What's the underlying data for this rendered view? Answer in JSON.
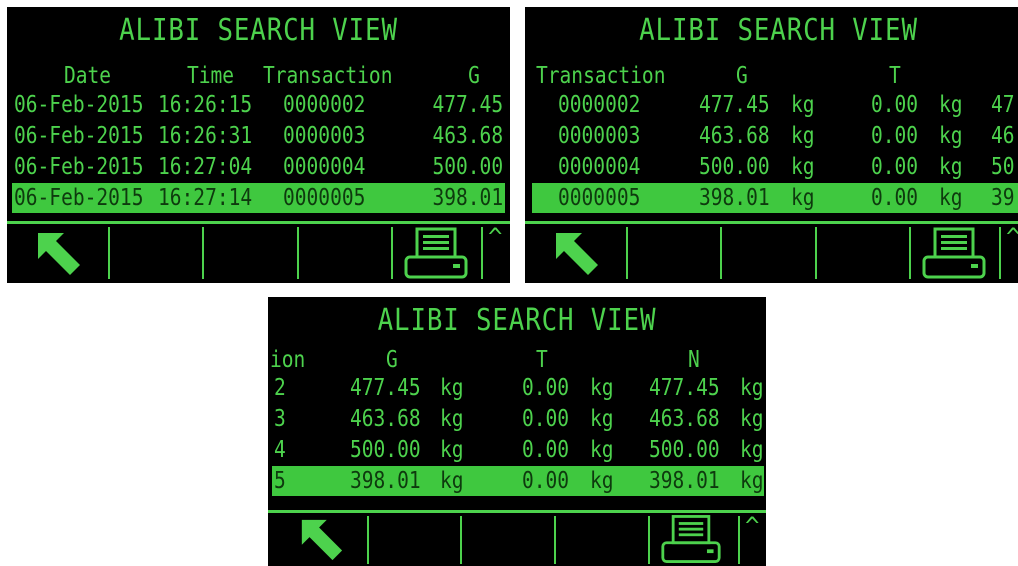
{
  "title": "ALIBI SEARCH VIEW",
  "colors": {
    "screen": "#000000",
    "text": "#4dd24d",
    "highlight": "#3fc83f",
    "highlight_text": "#0e3a0e"
  },
  "icons": {
    "back": "arrow-up-left-icon",
    "print": "printer-icon",
    "scroll": "caret-up-icon"
  },
  "scroll_glyph": "^",
  "panel1": {
    "headers": {
      "date": "Date",
      "time": "Time",
      "transaction": "Transaction",
      "g": "G"
    },
    "rows": [
      {
        "date": "06-Feb-2015",
        "time": "16:26:15",
        "transaction": "0000002",
        "g": "477.45"
      },
      {
        "date": "06-Feb-2015",
        "time": "16:26:31",
        "transaction": "0000003",
        "g": "463.68"
      },
      {
        "date": "06-Feb-2015",
        "time": "16:27:04",
        "transaction": "0000004",
        "g": "500.00"
      },
      {
        "date": "06-Feb-2015",
        "time": "16:27:14",
        "transaction": "0000005",
        "g": "398.01"
      }
    ]
  },
  "panel2": {
    "headers": {
      "transaction": "Transaction",
      "g": "G",
      "t": "T"
    },
    "rows": [
      {
        "transaction": "0000002",
        "g": "477.45",
        "g_unit": "kg",
        "t": "0.00",
        "t_unit": "kg",
        "clip": "47"
      },
      {
        "transaction": "0000003",
        "g": "463.68",
        "g_unit": "kg",
        "t": "0.00",
        "t_unit": "kg",
        "clip": "46"
      },
      {
        "transaction": "0000004",
        "g": "500.00",
        "g_unit": "kg",
        "t": "0.00",
        "t_unit": "kg",
        "clip": "50"
      },
      {
        "transaction": "0000005",
        "g": "398.01",
        "g_unit": "kg",
        "t": "0.00",
        "t_unit": "kg",
        "clip": "39"
      }
    ]
  },
  "panel3": {
    "headers": {
      "transaction": "ion",
      "g": "G",
      "t": "T",
      "n": "N"
    },
    "rows": [
      {
        "transaction": "2",
        "g": "477.45",
        "g_unit": "kg",
        "t": "0.00",
        "t_unit": "kg",
        "n": "477.45",
        "n_unit": "kg"
      },
      {
        "transaction": "3",
        "g": "463.68",
        "g_unit": "kg",
        "t": "0.00",
        "t_unit": "kg",
        "n": "463.68",
        "n_unit": "kg"
      },
      {
        "transaction": "4",
        "g": "500.00",
        "g_unit": "kg",
        "t": "0.00",
        "t_unit": "kg",
        "n": "500.00",
        "n_unit": "kg"
      },
      {
        "transaction": "5",
        "g": "398.01",
        "g_unit": "kg",
        "t": "0.00",
        "t_unit": "kg",
        "n": "398.01",
        "n_unit": "kg"
      }
    ]
  }
}
